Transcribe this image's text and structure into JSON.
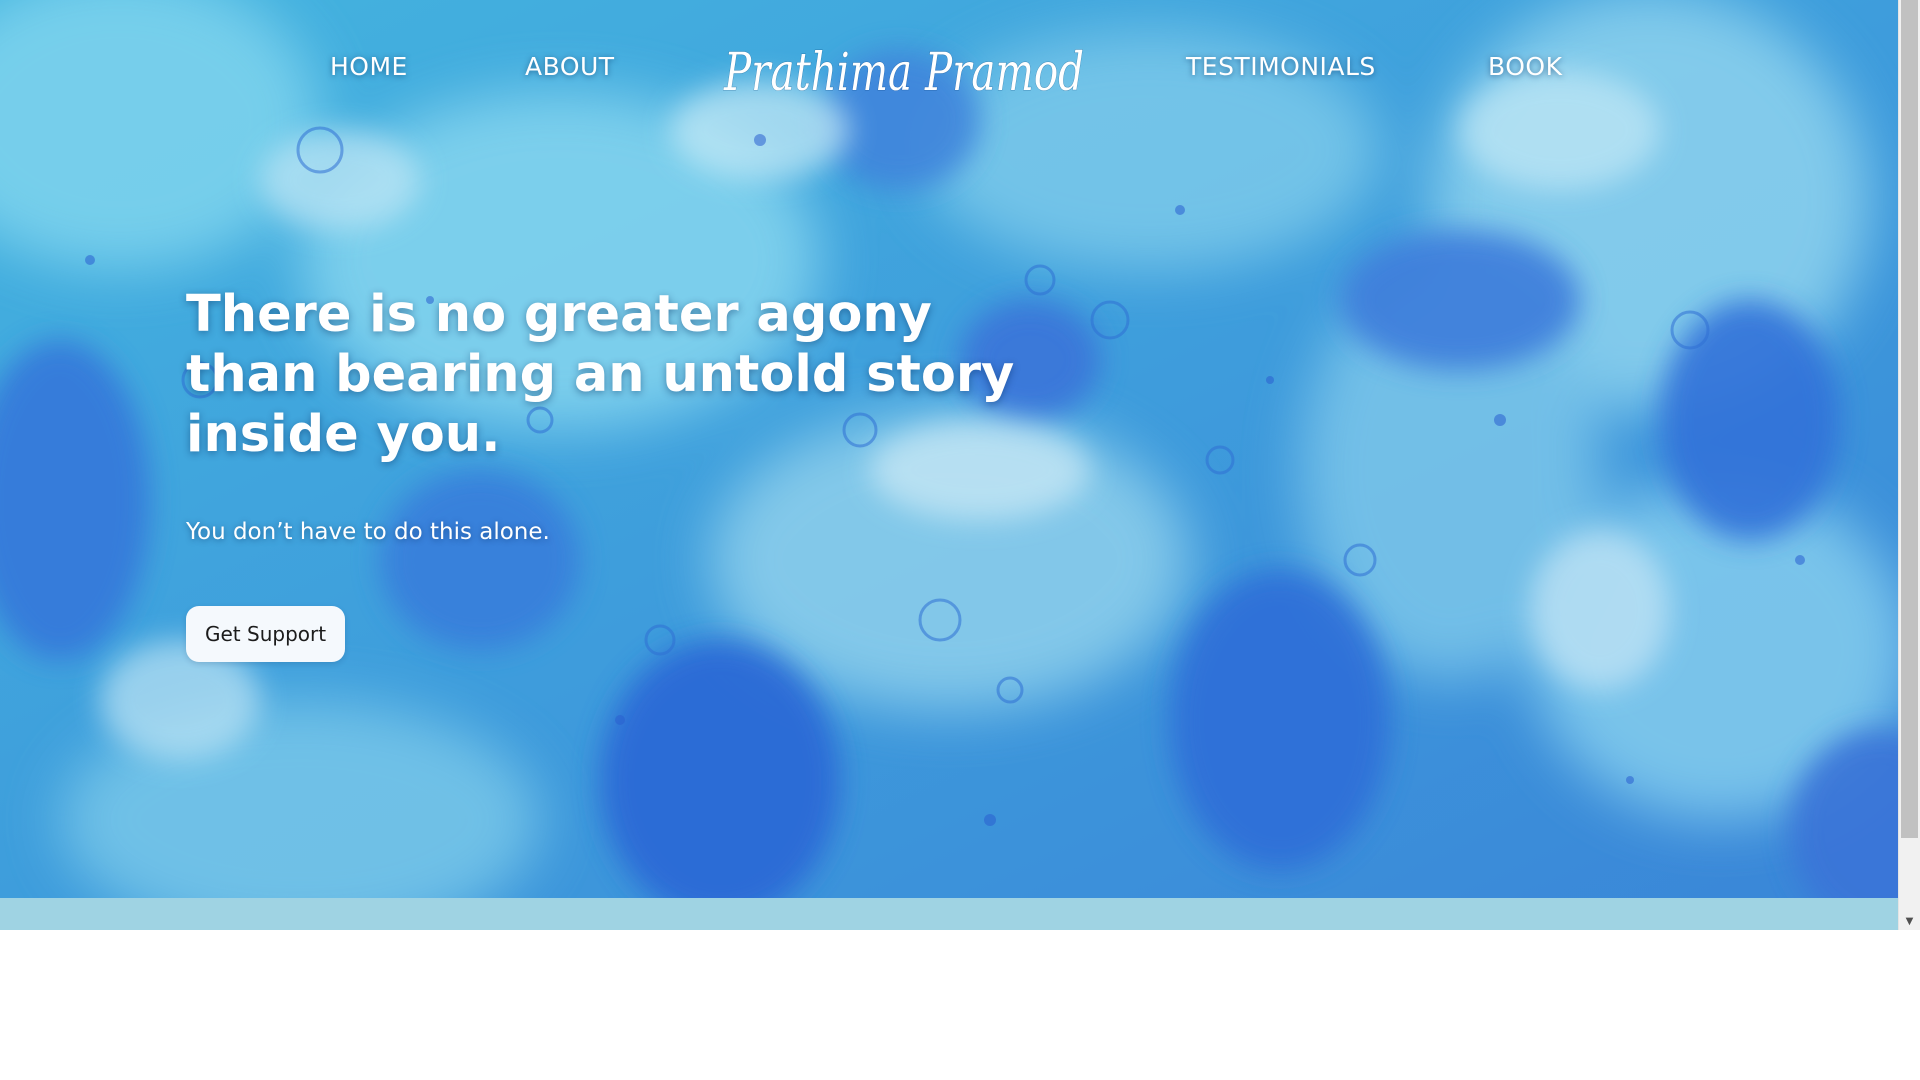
{
  "nav": {
    "home_label": "HOME",
    "about_label": "ABOUT",
    "logo_text": "Prathima Pramod",
    "testimonials_label": "TESTIMONIALS",
    "book_label": "BOOK"
  },
  "hero": {
    "headline": "There is no greater agony than bearing an untold story inside you.",
    "subhead": "You don’t have to do this alone.",
    "cta_label": "Get Support"
  },
  "colors": {
    "hero_base": "#3f9fd8",
    "hero_light": "#7fd0ec",
    "hero_dark": "#2d6fd6",
    "hero_strip": "#9fd3e3",
    "button_bg": "#f5f9fd",
    "text_on_hero": "#ffffff"
  },
  "icons": {
    "scroll_down": "scroll-down-arrow-icon"
  }
}
